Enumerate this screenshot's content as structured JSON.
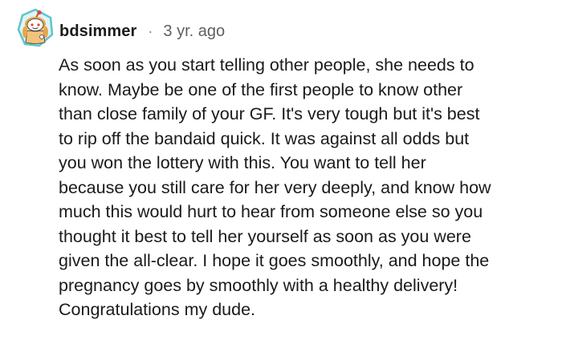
{
  "comment": {
    "username": "bdsimmer",
    "separator": "·",
    "timestamp": "3 yr. ago",
    "avatar_icon": "snoo-avatar-icon",
    "colors": {
      "avatar_ring": "#5ec4cc",
      "avatar_body": "#e8a64a",
      "username": "#1c1c1c",
      "timestamp": "#5f5f5f",
      "body": "#1a1a1b"
    },
    "body_lines": [
      "As soon as you start telling other people, she needs to",
      "know. Maybe be one of the first people to know other",
      "than close family of your GF. It's very tough but it's best",
      "to rip off the bandaid quick. It was against all odds but",
      "you won the lottery with this. You want to tell her",
      "because you still care for her very deeply, and know how",
      "much this would hurt to hear from someone else so you",
      "thought it best to tell her yourself as soon as you were",
      "given the all-clear. I hope it goes smoothly, and hope the",
      "pregnancy goes by smoothly with a healthy delivery!",
      "Congratulations my dude."
    ]
  }
}
